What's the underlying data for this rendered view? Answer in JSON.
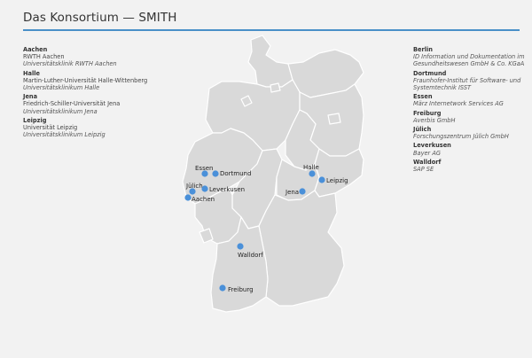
{
  "header": {
    "title": "Das Konsortium — SMITH"
  },
  "colors": {
    "accent": "#4a90c8",
    "map_fill": "#d9d9d9",
    "map_stroke": "#ffffff",
    "marker": "#4a90d9"
  },
  "partners_left": [
    {
      "city": "Aachen",
      "institutions": [
        {
          "name": "RWTH Aachen",
          "italic": false
        },
        {
          "name": "Universitätsklinik RWTH Aachen",
          "italic": true
        }
      ]
    },
    {
      "city": "Halle",
      "institutions": [
        {
          "name": "Martin-Luther-Universität Halle-Wittenberg",
          "italic": false
        },
        {
          "name": "Universitätsklinikum Halle",
          "italic": true
        }
      ]
    },
    {
      "city": "Jena",
      "institutions": [
        {
          "name": "Friedrich-Schiller-Universität Jena",
          "italic": false
        },
        {
          "name": "Universitätsklinikum Jena",
          "italic": true
        }
      ]
    },
    {
      "city": "Leipzig",
      "institutions": [
        {
          "name": "Universität Leipzig",
          "italic": false
        },
        {
          "name": "Universitätsklinikum Leipzig",
          "italic": true
        }
      ]
    }
  ],
  "partners_right": [
    {
      "city": "Berlin",
      "institutions": [
        {
          "name": "ID Information und Dokumentation im Gesundheitswesen GmbH & Co. KGaA",
          "italic": true
        }
      ]
    },
    {
      "city": "Dortmund",
      "institutions": [
        {
          "name": "Fraunhofer-Institut für Software- und Systemtechnik ISST",
          "italic": true
        }
      ]
    },
    {
      "city": "Essen",
      "institutions": [
        {
          "name": "März Internetwork Services AG",
          "italic": true
        }
      ]
    },
    {
      "city": "Freiburg",
      "institutions": [
        {
          "name": "Averbis GmbH",
          "italic": true
        }
      ]
    },
    {
      "city": "Jülich",
      "institutions": [
        {
          "name": "Forschungszentrum Jülich GmbH",
          "italic": true
        }
      ]
    },
    {
      "city": "Leverkusen",
      "institutions": [
        {
          "name": "Bayer AG",
          "italic": true
        }
      ]
    },
    {
      "city": "Walldorf",
      "institutions": [
        {
          "name": "SAP SE",
          "italic": true
        }
      ]
    }
  ],
  "map_markers": [
    {
      "label": "Essen"
    },
    {
      "label": "Dortmund"
    },
    {
      "label": "Jülich"
    },
    {
      "label": "Leverkusen"
    },
    {
      "label": "Aachen"
    },
    {
      "label": "Halle"
    },
    {
      "label": "Leipzig"
    },
    {
      "label": "Jena"
    },
    {
      "label": "Walldorf"
    },
    {
      "label": "Freiburg"
    }
  ]
}
